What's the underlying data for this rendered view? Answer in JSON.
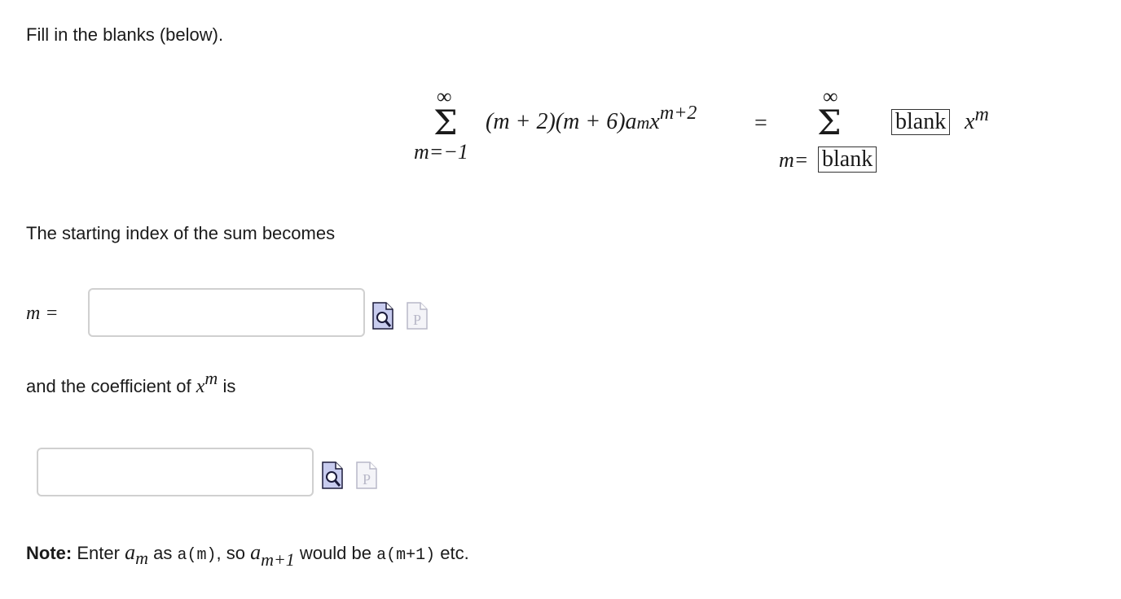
{
  "prompt": "Fill in the blanks (below).",
  "equation": {
    "lhs_upper": "∞",
    "sigma": "Σ",
    "lhs_lower": "m=−1",
    "lhs_term": "(m + 2)(m + 6)a",
    "lhs_sub": "m",
    "lhs_var": "x",
    "lhs_exp": "m+2",
    "equals": "=",
    "rhs_upper": "∞",
    "rhs_lower_prefix": "m=",
    "blank": "blank",
    "rhs_var": "x",
    "rhs_exp": "m"
  },
  "start_index_text": "The starting index of the sum becomes",
  "m_label": "m =",
  "m_input_value": "",
  "coef_text_before": "and the coefficient of",
  "coef_var": "x",
  "coef_exp": "m",
  "coef_text_after": "is",
  "coef_input_value": "",
  "note": {
    "bold": "Note:",
    "t1": "Enter",
    "am_base": "a",
    "am_sub": "m",
    "t2": "as",
    "code1": "a(m)",
    "t3": ", so",
    "am1_base": "a",
    "am1_sub": "m+1",
    "t4": "would be",
    "code2": "a(m+1)",
    "t5": "etc."
  }
}
